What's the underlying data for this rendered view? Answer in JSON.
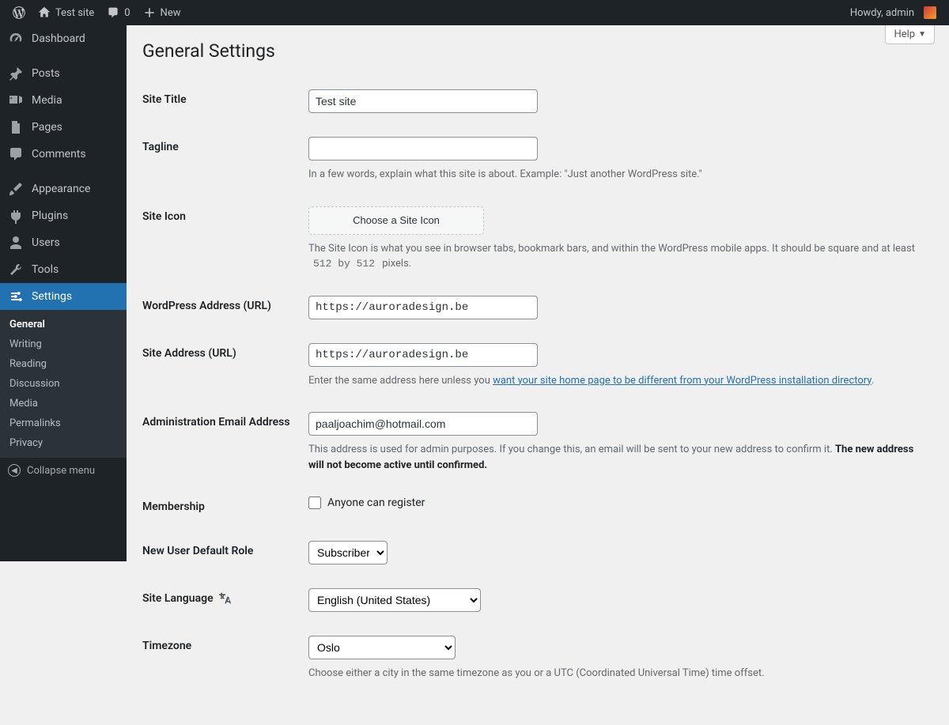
{
  "adminbar": {
    "site_title": "Test site",
    "comments_count": "0",
    "new_label": "New",
    "howdy": "Howdy, admin"
  },
  "menu": {
    "dashboard": "Dashboard",
    "posts": "Posts",
    "media": "Media",
    "pages": "Pages",
    "comments": "Comments",
    "appearance": "Appearance",
    "plugins": "Plugins",
    "users": "Users",
    "tools": "Tools",
    "settings": "Settings",
    "submenu": {
      "general": "General",
      "writing": "Writing",
      "reading": "Reading",
      "discussion": "Discussion",
      "media": "Media",
      "permalinks": "Permalinks",
      "privacy": "Privacy"
    },
    "collapse": "Collapse menu"
  },
  "help_label": "Help",
  "page_title": "General Settings",
  "fields": {
    "site_title": {
      "label": "Site Title",
      "value": "Test site"
    },
    "tagline": {
      "label": "Tagline",
      "value": "",
      "description": "In a few words, explain what this site is about. Example: \"Just another WordPress site.\""
    },
    "site_icon": {
      "label": "Site Icon",
      "button": "Choose a Site Icon",
      "description_before": "The Site Icon is what you see in browser tabs, bookmark bars, and within the WordPress mobile apps. It should be square and at least ",
      "code": "512 by 512",
      "description_after": " pixels."
    },
    "wp_url": {
      "label": "WordPress Address (URL)",
      "value": "https://auroradesign.be"
    },
    "site_url": {
      "label": "Site Address (URL)",
      "value": "https://auroradesign.be",
      "description_before": "Enter the same address here unless you ",
      "link_text": "want your site home page to be different from your WordPress installation directory",
      "description_after": "."
    },
    "admin_email": {
      "label": "Administration Email Address",
      "value": "paaljoachim@hotmail.com",
      "description_plain": "This address is used for admin purposes. If you change this, an email will be sent to your new address to confirm it. ",
      "description_strong": "The new address will not become active until confirmed."
    },
    "membership": {
      "label": "Membership",
      "checkbox_label": "Anyone can register"
    },
    "default_role": {
      "label": "New User Default Role",
      "value": "Subscriber"
    },
    "site_language": {
      "label": "Site Language",
      "value": "English (United States)"
    },
    "timezone": {
      "label": "Timezone",
      "value": "Oslo",
      "description": "Choose either a city in the same timezone as you or a UTC (Coordinated Universal Time) time offset."
    }
  }
}
